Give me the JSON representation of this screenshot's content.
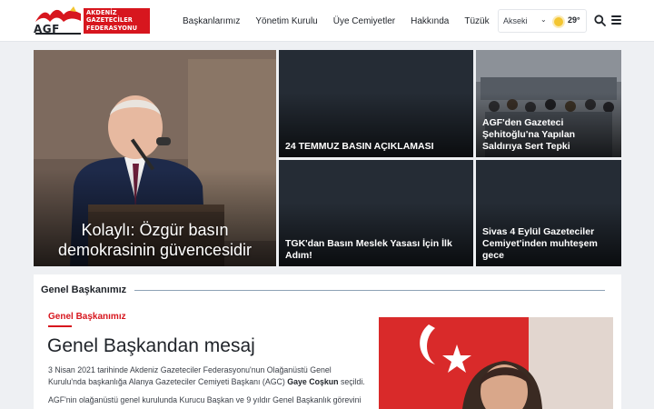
{
  "brand": {
    "mark_text": "AGF",
    "name_lines": [
      "AKDENİZ",
      "GAZETECİLER",
      "FEDERASYONU"
    ],
    "red": "#d7161e"
  },
  "nav": {
    "items": [
      "Başkanlarımız",
      "Yönetim Kurulu",
      "Üye Cemiyetler",
      "Hakkında",
      "Tüzük"
    ]
  },
  "weather": {
    "city": "Akseki",
    "temperature": "29°",
    "icon": "sun-icon"
  },
  "header_icons": [
    "search-icon",
    "hamburger-menu-icon"
  ],
  "news": {
    "main": {
      "title": "Kolaylı: Özgür basın demokrasinin güvencesidir"
    },
    "items": [
      {
        "title": "24 TEMMUZ BASIN AÇIKLAMASI"
      },
      {
        "title": "AGF'den Gazeteci Şehitoğlu'na Yapılan Saldırıya Sert Tepki"
      },
      {
        "title": "TGK'dan Basın Meslek Yasası İçin İlk Adım!"
      },
      {
        "title": "Sivas 4 Eylül Gazeteciler Cemiyet'inden muhteşem gece"
      }
    ]
  },
  "section": {
    "heading": "Genel Başkanımız",
    "kicker": "Genel Başkanımız",
    "headline": "Genel Başkandan mesaj",
    "p1_text": "3 Nisan 2021 tarihinde Akdeniz Gazeteciler Federasyonu'nun Olağanüstü Genel Kurulu'nda başkanlığa Alanya Gazeteciler Cemiyeti Başkanı (AGC) ",
    "p1_name": "Gaye Coşkun",
    "p1_end": " seçildi.",
    "p2_text": "AGF'nin olağanüstü genel kurulunda Kurucu Başkan ve 9 yıldır Genel Başkanlık görevini"
  }
}
